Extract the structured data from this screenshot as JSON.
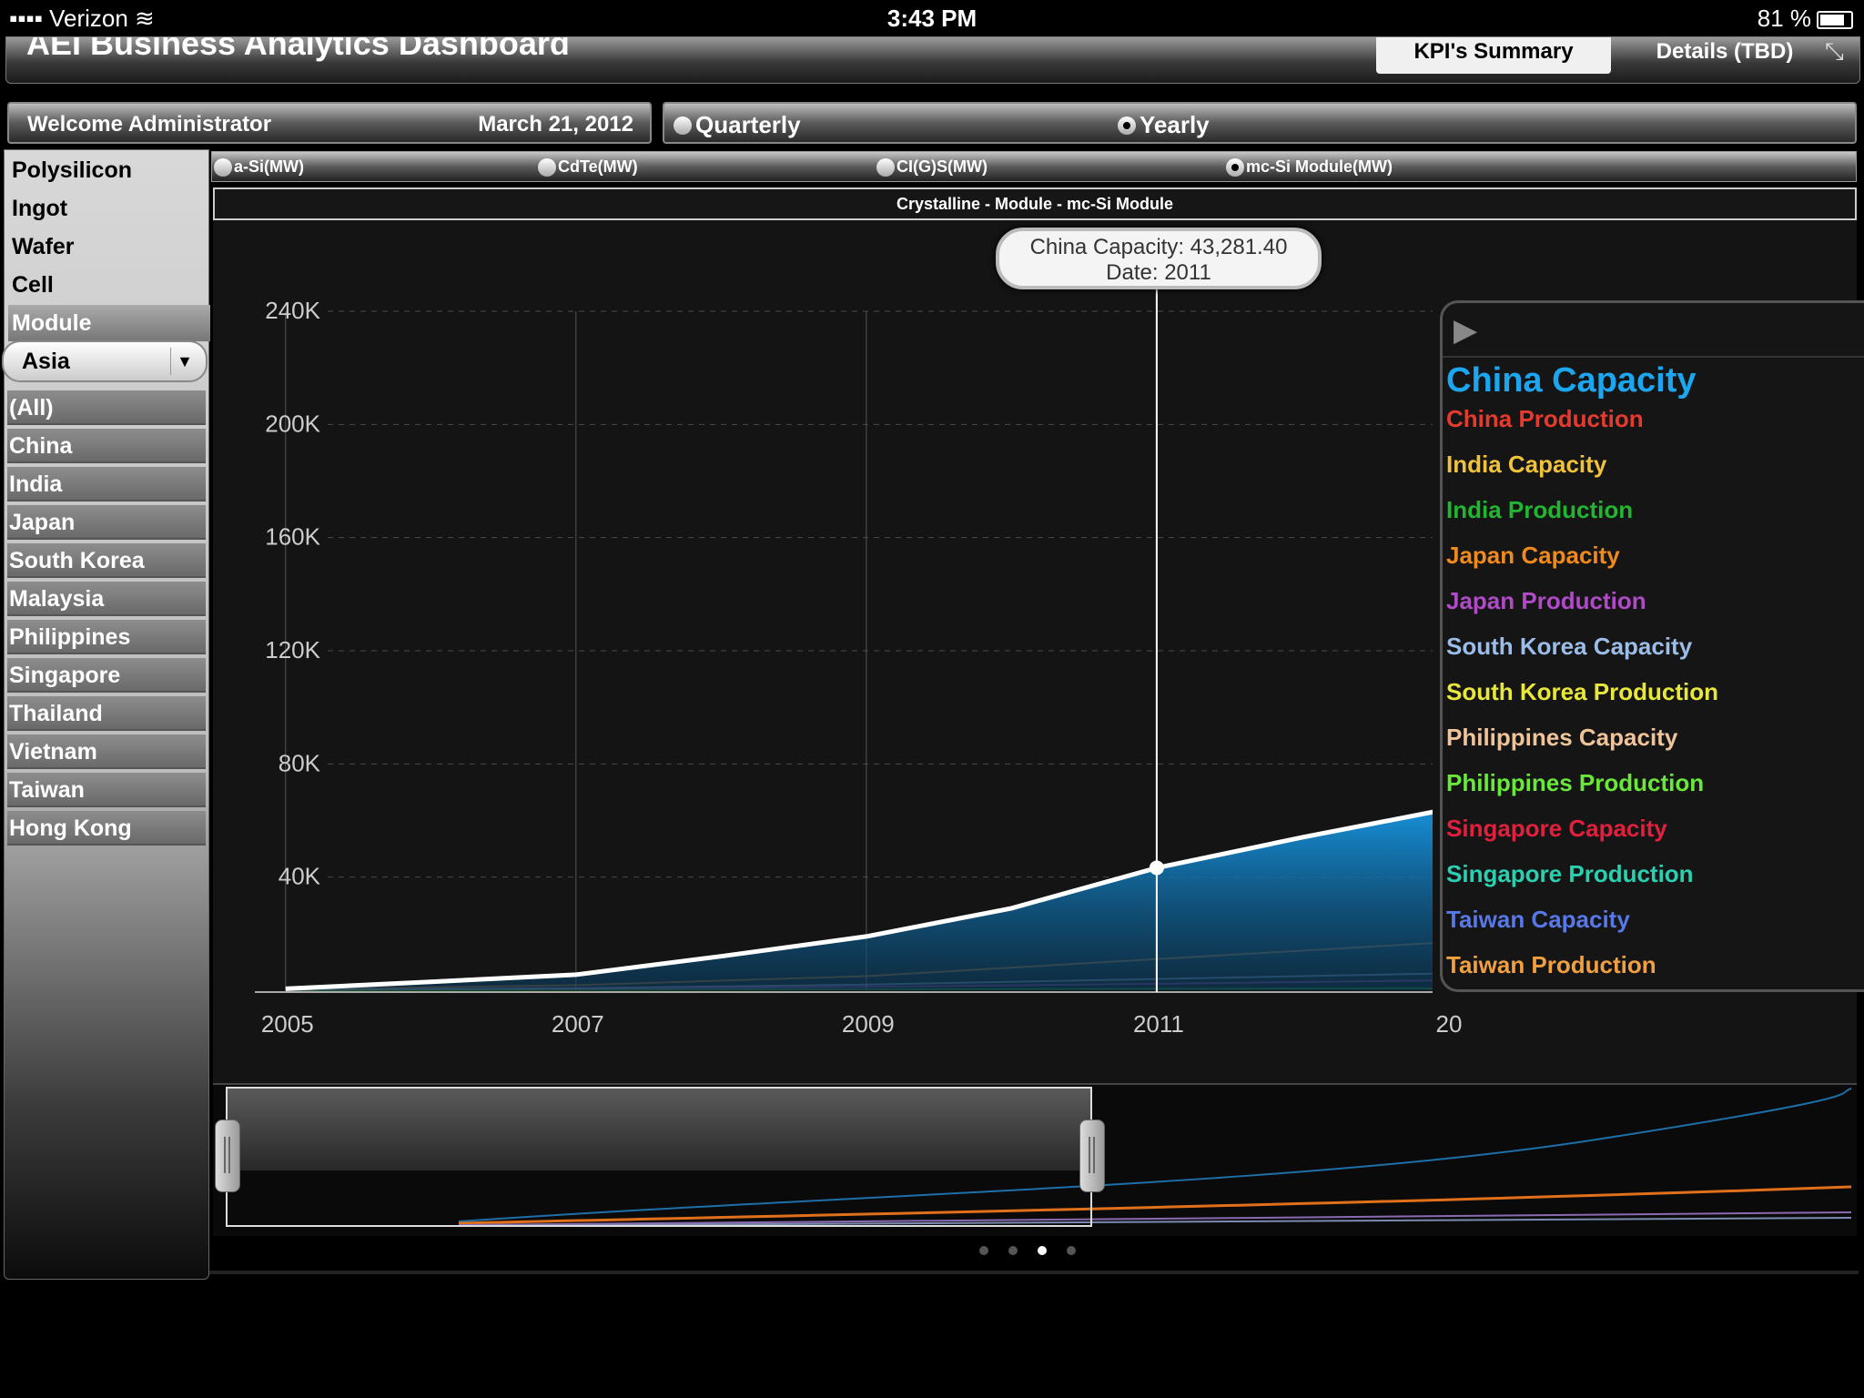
{
  "status_bar": {
    "carrier": "Verizon",
    "time": "3:43 PM",
    "battery": "81 %",
    "battery_level": 0.81
  },
  "header": {
    "title": "AEI Business Analytics Dashboard",
    "tabs": [
      "KPI's Summary",
      "Details (TBD)"
    ],
    "active_tab": 0
  },
  "welcome": {
    "text": "Welcome Administrator",
    "date": "March 21, 2012"
  },
  "period": {
    "options": [
      "Quarterly",
      "Yearly"
    ],
    "selected": "Yearly"
  },
  "stages": {
    "items": [
      "Polysilicon",
      "Ingot",
      "Wafer",
      "Cell",
      "Module"
    ],
    "active": "Module"
  },
  "region": {
    "selected": "Asia"
  },
  "countries": [
    "(All)",
    "China",
    "India",
    "Japan",
    "South Korea",
    "Malaysia",
    "Philippines",
    "Singapore",
    "Thailand",
    "Vietnam",
    "Taiwan",
    "Hong Kong"
  ],
  "tech": {
    "options": [
      "a-Si(MW)",
      "CdTe(MW)",
      "CI(G)S(MW)",
      "mc-Si Module(MW)"
    ],
    "selected": "mc-Si Module(MW)"
  },
  "chart_title": "Crystalline - Module - mc-Si Module",
  "tooltip": {
    "line1": "China Capacity: 43,281.40",
    "line2": "Date:  2011"
  },
  "legend": {
    "items": [
      {
        "label": "China Capacity",
        "color": "#1da6f0"
      },
      {
        "label": "China Production",
        "color": "#e63a2e"
      },
      {
        "label": "India Capacity",
        "color": "#f0c23a"
      },
      {
        "label": "India Production",
        "color": "#22b530"
      },
      {
        "label": "Japan Capacity",
        "color": "#f08a1c"
      },
      {
        "label": "Japan Production",
        "color": "#b04ac8"
      },
      {
        "label": "South Korea Capacity",
        "color": "#9cbde8"
      },
      {
        "label": "South Korea Production",
        "color": "#e8e83a"
      },
      {
        "label": "Philippines Capacity",
        "color": "#f0c49a"
      },
      {
        "label": "Philippines Production",
        "color": "#6ae83a"
      },
      {
        "label": "Singapore Capacity",
        "color": "#e0203c"
      },
      {
        "label": "Singapore Production",
        "color": "#2ad0b0"
      },
      {
        "label": "Taiwan Capacity",
        "color": "#5878e8"
      },
      {
        "label": "Taiwan Production",
        "color": "#f0a040"
      }
    ],
    "active": "China Capacity"
  },
  "navigator": {
    "pages": 4,
    "current_page": 3
  },
  "chart_data": {
    "type": "area",
    "title": "Crystalline - Module - mc-Si Module",
    "x_ticks": [
      "2005",
      "2007",
      "2009",
      "2011",
      "20"
    ],
    "y_ticks": [
      "40K",
      "80K",
      "120K",
      "160K",
      "200K",
      "240K"
    ],
    "ylim": [
      0,
      240000
    ],
    "xlim": [
      2004.5,
      2012.9
    ],
    "grid": true,
    "legend_position": "right",
    "series": [
      {
        "name": "China Capacity",
        "color": "#1da6f0",
        "x": [
          2005,
          2006,
          2007,
          2008,
          2009,
          2010,
          2011,
          2012,
          2013
        ],
        "values": [
          500,
          3000,
          5500,
          12000,
          19000,
          29000,
          43281.4,
          54000,
          64000
        ]
      },
      {
        "name": "Japan Capacity",
        "color": "#f08a1c",
        "x": [
          2005,
          2007,
          2009,
          2011,
          2013
        ],
        "values": [
          300,
          1800,
          5000,
          11000,
          17000
        ]
      },
      {
        "name": "South Korea Capacity",
        "color": "#9cbde8",
        "x": [
          2005,
          2007,
          2009,
          2011,
          2013
        ],
        "values": [
          200,
          700,
          2000,
          4000,
          6000
        ]
      },
      {
        "name": "Japan Production",
        "color": "#b04ac8",
        "x": [
          2005,
          2007,
          2009,
          2011,
          2013
        ],
        "values": [
          100,
          500,
          1200,
          2300,
          3500
        ]
      },
      {
        "name": "India Production",
        "color": "#22b530",
        "x": [
          2005,
          2007,
          2009,
          2011,
          2013
        ],
        "values": [
          50,
          150,
          300,
          500,
          700
        ]
      }
    ]
  }
}
